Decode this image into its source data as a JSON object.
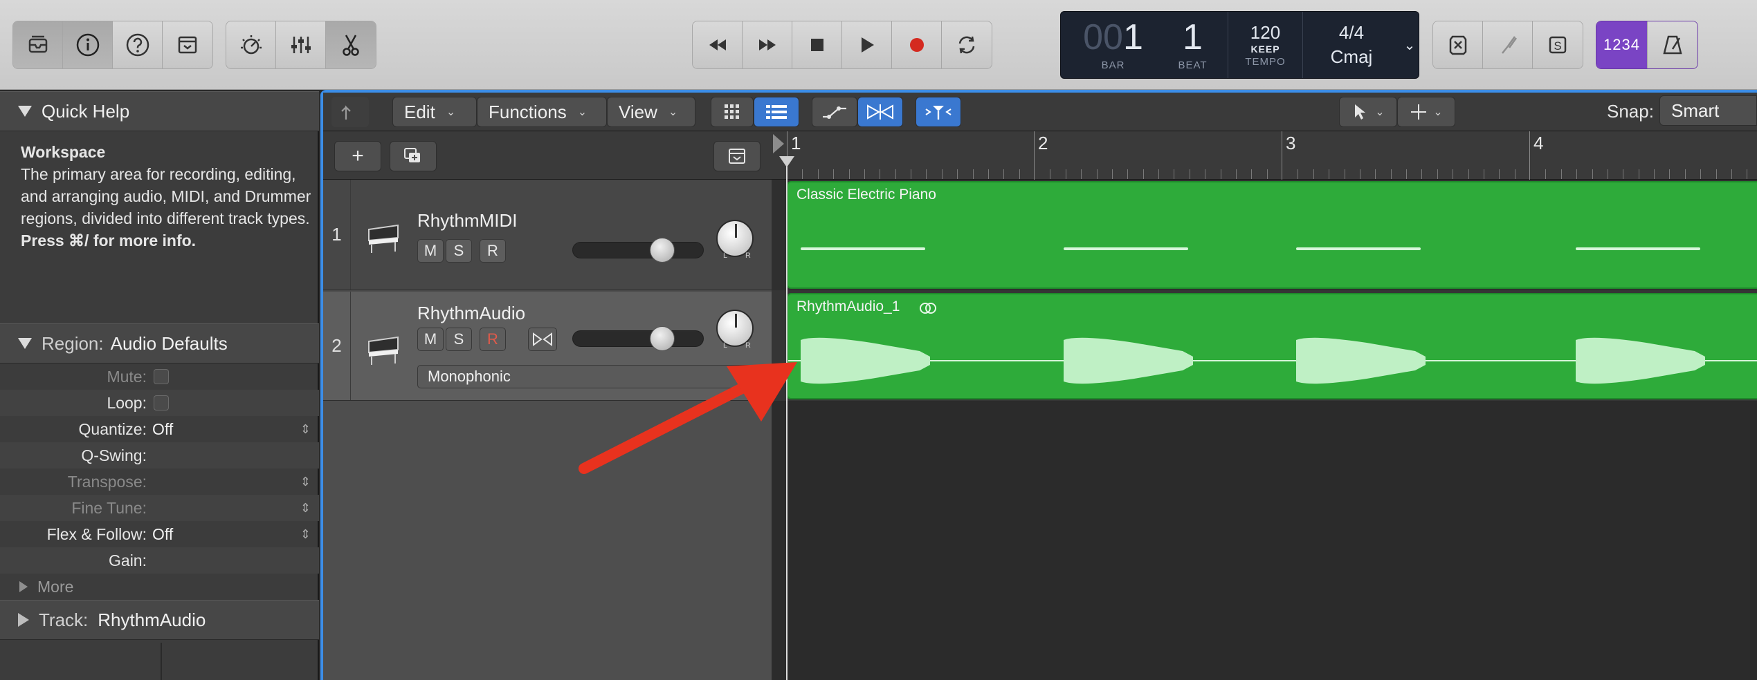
{
  "control_bar": {
    "lcd": {
      "bar_dim": "00",
      "bar": "1",
      "beat": "1",
      "bar_label": "BAR",
      "beat_label": "BEAT",
      "tempo": "120",
      "tempo_mode": "KEEP",
      "tempo_label": "TEMPO",
      "time_signature": "4/4",
      "key": "Cmaj"
    },
    "count_in_label": "1234",
    "solo_label": "S"
  },
  "local_bar": {
    "menus": [
      {
        "label": "Edit"
      },
      {
        "label": "Functions"
      },
      {
        "label": "View"
      }
    ],
    "snap_label": "Snap:",
    "snap_value": "Smart"
  },
  "inspector": {
    "quick_help": {
      "header": "Quick Help",
      "title": "Workspace",
      "body": "The primary area for recording, editing, and arranging audio, MIDI, and Drummer regions, divided into different track types.",
      "hint": "Press ⌘/ for more info."
    },
    "region": {
      "header_prefix": "Region:",
      "header_value": "Audio Defaults",
      "params": [
        {
          "label": "Mute:",
          "value": ""
        },
        {
          "label": "Loop:",
          "value": ""
        },
        {
          "label": "Quantize:",
          "value": "Off"
        },
        {
          "label": "Q-Swing:",
          "value": ""
        },
        {
          "label": "Transpose:",
          "value": ""
        },
        {
          "label": "Fine Tune:",
          "value": ""
        },
        {
          "label": "Flex & Follow:",
          "value": "Off"
        },
        {
          "label": "Gain:",
          "value": ""
        }
      ],
      "more_label": "More"
    },
    "track": {
      "header_prefix": "Track:",
      "header_value": "RhythmAudio"
    }
  },
  "ruler": {
    "bars": [
      "1",
      "2",
      "3",
      "4"
    ]
  },
  "tracks": [
    {
      "number": "1",
      "name": "RhythmMIDI",
      "mute": "M",
      "solo": "S",
      "rec": "R",
      "pan_l": "L",
      "pan_r": "R"
    },
    {
      "number": "2",
      "name": "RhythmAudio",
      "mute": "M",
      "solo": "S",
      "rec": "R",
      "pan_l": "L",
      "pan_r": "R",
      "flex_mode": "Monophonic"
    }
  ],
  "regions": [
    {
      "name": "Classic Electric Piano"
    },
    {
      "name": "RhythmAudio_1"
    }
  ],
  "colors": {
    "region_green": "#2eab3a",
    "selection_blue": "#3c8ee8",
    "annotation_arrow": "#e8321e",
    "count_in_purple": "#7a44c4"
  }
}
